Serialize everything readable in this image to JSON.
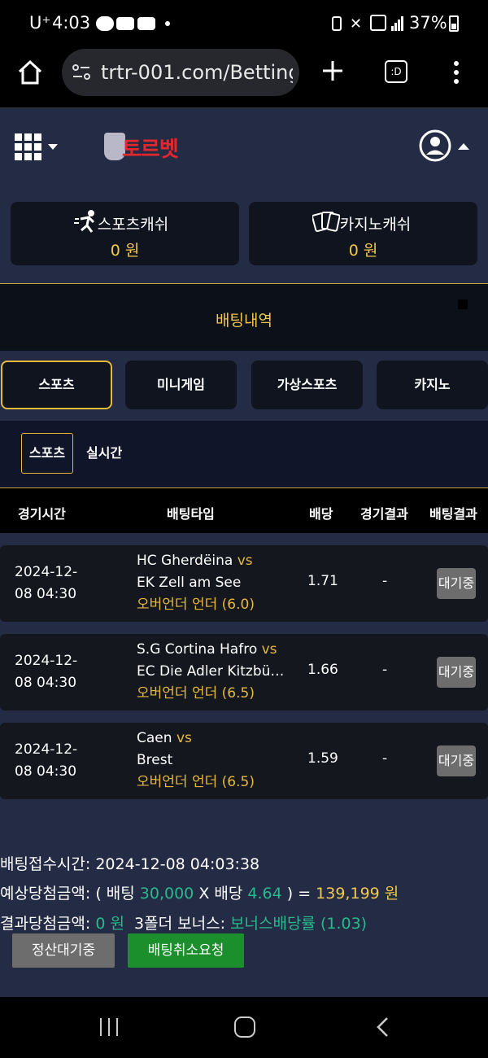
{
  "status_bar": {
    "carrier": "U⁺",
    "time": "4:03",
    "battery": "37%",
    "icons": [
      "talk-icon",
      "youtube-icon",
      "youtube-icon",
      "dot-icon",
      "sync-icon",
      "mute-icon",
      "5g-icon",
      "signal-icon",
      "battery-icon"
    ]
  },
  "browser": {
    "url": "trtr-001.com/Betting",
    "tab_switcher_label": ":D"
  },
  "header": {
    "logo_text": "토르벳"
  },
  "cash": [
    {
      "label": "스포츠캐쉬",
      "value": "0 원"
    },
    {
      "label": "카지노캐쉬",
      "value": "0 원"
    }
  ],
  "page_title": "배팅내역",
  "tabs": [
    {
      "label": "스포츠"
    },
    {
      "label": "미니게임"
    },
    {
      "label": "가상스포츠"
    },
    {
      "label": "카지노"
    }
  ],
  "subtabs": [
    {
      "label": "스포츠"
    },
    {
      "label": "실시간"
    }
  ],
  "table": {
    "headers": [
      "경기시간",
      "배팅타입",
      "배당",
      "경기결과",
      "배팅결과"
    ],
    "rows": [
      {
        "date": "2024-12-",
        "time": "08 04:30",
        "home": "HC Gherdëina",
        "vs": "vs",
        "away": "EK Zell am See",
        "bet_type": "오버언더 언더 (6.0)",
        "odds": "1.71",
        "result": "-",
        "status": "대기중"
      },
      {
        "date": "2024-12-",
        "time": "08 04:30",
        "home": "S.G Cortina Hafro",
        "vs": "vs",
        "away": "EC Die Adler Kitzbü…",
        "bet_type": "오버언더 언더 (6.5)",
        "odds": "1.66",
        "result": "-",
        "status": "대기중"
      },
      {
        "date": "2024-12-",
        "time": "08 04:30",
        "home": "Caen",
        "vs": "vs",
        "away": "Brest",
        "bet_type": "오버언더 언더 (6.5)",
        "odds": "1.59",
        "result": "-",
        "status": "대기중"
      }
    ]
  },
  "summary": {
    "received_label": "배팅접수시간:",
    "received_value": "2024-12-08 04:03:38",
    "expected_label": "예상당첨금액: ( 배팅",
    "bet_amount": "30,000",
    "x_label": "X 배당",
    "total_odds": "4.64",
    "close_paren": ") =",
    "expected_amount": "139,199 원",
    "result_label": "결과당첨금액:",
    "result_amount": "0 원",
    "bonus_label": "3폴더 보너스:",
    "bonus_value": "보너스배당률 (1.03)"
  },
  "buttons": {
    "settle": "정산대기중",
    "cancel": "배팅취소요청"
  },
  "colors": {
    "gold": "#f2c94c",
    "green": "#29b98c",
    "button_green": "#1a8f2c",
    "background": "#232b45"
  }
}
